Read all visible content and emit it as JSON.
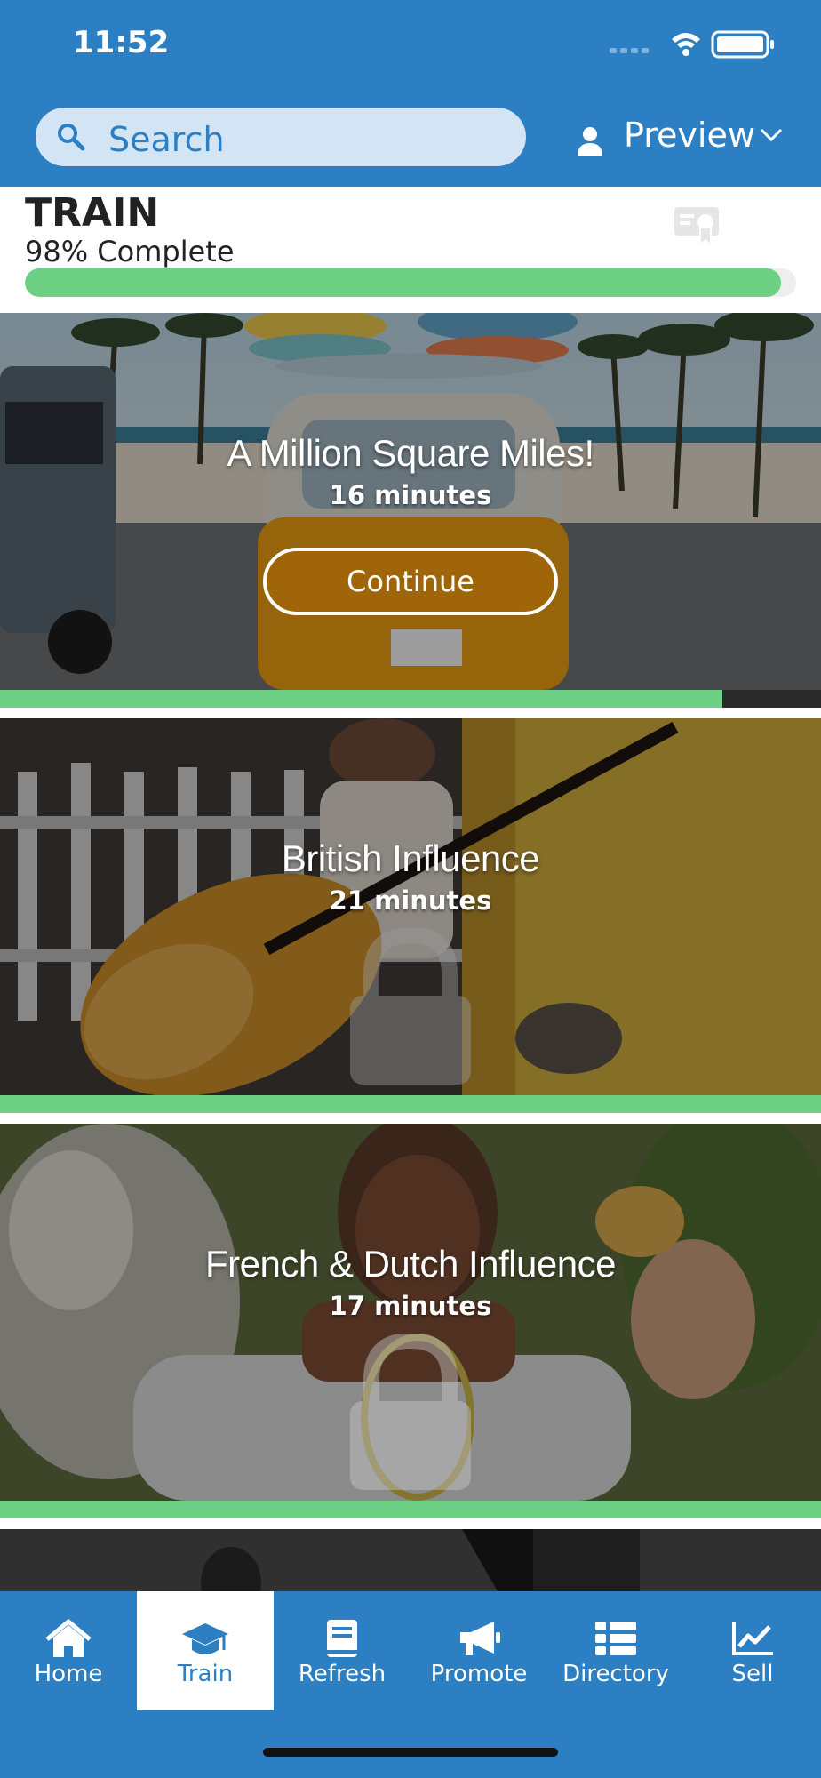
{
  "status_bar": {
    "time": "11:52"
  },
  "header": {
    "search": {
      "placeholder": "Search"
    },
    "preview_label": "Preview"
  },
  "train": {
    "title": "TRAIN",
    "complete_text": "98% Complete",
    "progress_percent": 98
  },
  "cards": [
    {
      "title": "A Million Square Miles!",
      "duration": "16 minutes",
      "button_label": "Continue",
      "locked": false,
      "progress_percent": 88
    },
    {
      "title": "British Influence",
      "duration": "21 minutes",
      "locked": true,
      "progress_percent": 100
    },
    {
      "title": "French & Dutch Influence",
      "duration": "17 minutes",
      "locked": true,
      "progress_percent": 100
    }
  ],
  "bottom_nav": {
    "items": [
      {
        "label": "Home",
        "icon": "home-icon",
        "active": false
      },
      {
        "label": "Train",
        "icon": "graduation-cap-icon",
        "active": true
      },
      {
        "label": "Refresh",
        "icon": "book-icon",
        "active": false
      },
      {
        "label": "Promote",
        "icon": "megaphone-icon",
        "active": false
      },
      {
        "label": "Directory",
        "icon": "list-icon",
        "active": false
      },
      {
        "label": "Sell",
        "icon": "chart-line-icon",
        "active": false
      }
    ]
  },
  "colors": {
    "brand_blue": "#2d7fc4",
    "progress_green": "#6ed084",
    "search_bg": "#d3e5f5"
  }
}
